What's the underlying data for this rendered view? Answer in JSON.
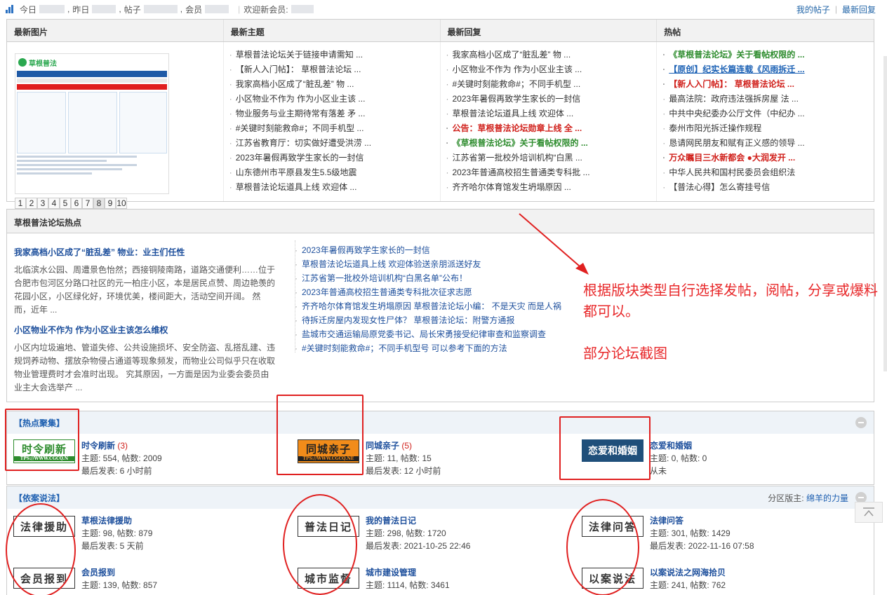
{
  "stats": {
    "today": "今日",
    "yesterday": "昨日",
    "posts": "帖子",
    "members": "会员",
    "welcome": "欢迎新会员:",
    "my_posts": "我的帖子",
    "latest_replies_link": "最新回复"
  },
  "grid": {
    "headers": [
      "最新图片",
      "最新主题",
      "最新回复",
      "热帖"
    ],
    "pager": [
      "1",
      "2",
      "3",
      "4",
      "5",
      "6",
      "7",
      "8",
      "9",
      "10"
    ],
    "pager_active": "8",
    "thumb_site": "草根普法",
    "new_topics": [
      "草根普法论坛关于链接申请需知 ...",
      "【新人入门帖】： 草根普法论坛 ...",
      "我家高档小区成了“脏乱差” 物 ...",
      "小区物业不作为 作为小区业主该 ...",
      "物业服务与业主期待常有落差 矛 ...",
      "#关键时刻能救命#；不同手机型 ...",
      "江苏省教育厅：切实做好遭受洪涝 ...",
      "2023年暑假再致学生家长的一封信",
      "山东德州市平原县发生5.5级地震",
      "草根普法论坛道具上线 欢迎体 ..."
    ],
    "new_replies": [
      "我家高档小区成了“脏乱差” 物 ...",
      "小区物业不作为 作为小区业主该 ...",
      "#关键时刻能救命#；不同手机型 ...",
      "2023年暑假再致学生家长的一封信",
      "草根普法论坛道具上线 欢迎体 ...",
      "公告：草根普法论坛勋章上线 全 ...",
      "《草根普法论坛》关于看帖权限的 ...",
      "江苏省第一批校外培训机构“白黑 ...",
      "2023年普通高校招生普通类专科批 ...",
      "齐齐哈尔体育馆发生坍塌原因 ..."
    ],
    "reply_styles": [
      "",
      "",
      "",
      "",
      "",
      "red",
      "green",
      "",
      "",
      ""
    ],
    "hot_posts": [
      "《草根普法论坛》关于看帖权限的 ...",
      "【原创】纪实长篇连载《风雨拆迁 ...",
      "【新人入门帖】： 草根普法论坛 ...",
      "最高法院：政府违法强拆房屋 法 ...",
      "中共中央纪委办公厅文件（中纪办 ...",
      "泰州市阳光拆迁操作规程",
      "恳请网民朋友和赋有正义感的领导 ...",
      "万众瞩目三水新都会 ●大润发开 ...",
      "中华人民共和国村民委员会组织法",
      "【普法心得】怎么寄挂号信"
    ],
    "hot_styles": [
      "green",
      "blue",
      "red",
      "",
      "",
      "",
      "",
      "red",
      "",
      ""
    ]
  },
  "hot_section": {
    "title": "草根普法论坛热点",
    "articles": [
      {
        "title": "我家高档小区成了“脏乱差” 物业：业主们任性",
        "body": "北临滨水公园、周遭景色怡然；西接铜陵南路，道路交通便利……位于合肥市包河区分路口社区的元一柏庄小区，本是居民点赞、周边艳羡的花园小区，小区绿化好，环境优美，楼间距大，活动空间开阔。 然而，近年 ..."
      },
      {
        "title": "小区物业不作为 作为小区业主该怎么维权",
        "body": "小区内垃圾遍地、管道失修、公共设施损坏、安全防盗、乱搭乱建、违规饲养动物、摆放杂物侵占通道等现象频发，而物业公司似乎只在收取物业管理费时才会准时出现。 究其原因，一方面是因为业委会委员由业主大会选举产 ..."
      }
    ],
    "list": [
      "2023年暑假再致学生家长的一封信",
      "草根普法论坛道具上线 欢迎体验送亲朋派送好友",
      "江苏省第一批校外培训机构“白黑名单”公布！",
      "2023年普通高校招生普通类专科批次征求志愿",
      "齐齐哈尔体育馆发生坍塌原因 草根普法论坛小编： 不是天灾 而是人祸",
      "待拆迁房屋内发现女性尸体？ 草根普法论坛：附警方通报",
      "盐城市交通运输局原党委书记、局长宋勇接受纪律审查和监察调查",
      "#关键时刻能救命#；不同手机型号 可以参考下面的方法"
    ]
  },
  "annotation": {
    "line1": "根据版块类型自行选择发帖，阅帖，分享或爆料都可以。",
    "line2": "部分论坛截图"
  },
  "hotfocus": {
    "title": "【热点聚集】",
    "forums": [
      {
        "logo": "时令刷新",
        "logo_sub": "TPS://WWW.CGCQ.N",
        "name": "时令刷新",
        "count": "(3)",
        "stats": "主题: 554, 帖数: 2009",
        "last": "最后发表: 6 小时前"
      },
      {
        "logo": "同城亲子",
        "logo_sub": "TPS://WWW.CGCQ.NE",
        "name": "同城亲子",
        "count": "(5)",
        "stats": "主题: 11, 帖数: 15",
        "last": "最后发表: 12 小时前"
      },
      {
        "logo": "恋爱和婚姻",
        "logo_sub": "",
        "name": "恋爱和婚姻",
        "count": "",
        "stats": "主题: 0, 帖数: 0",
        "last": "从未"
      }
    ]
  },
  "caselaw": {
    "title": "【依案说法】",
    "moderator_label": "分区版主:",
    "moderator": "绵羊的力量",
    "forums": [
      {
        "logo": "法律援助",
        "name": "草根法律援助",
        "stats": "主题: 98, 帖数: 879",
        "last": "最后发表: 5 天前"
      },
      {
        "logo": "普法日记",
        "name": "我的普法日记",
        "stats": "主题: 298, 帖数: 1720",
        "last": "最后发表: 2021-10-25 22:46"
      },
      {
        "logo": "法律问答",
        "name": "法律问答",
        "stats": "主题: 301, 帖数: 1429",
        "last": "最后发表: 2022-11-16 07:58"
      },
      {
        "logo": "会员报到",
        "name": "会员报到",
        "stats": "主题: 139, 帖数: 857",
        "last": ""
      },
      {
        "logo": "城市监督",
        "name": "城市建设管理",
        "stats": "主题: 1114, 帖数: 3461",
        "last": ""
      },
      {
        "logo": "以案说法",
        "name": "以案说法之网海拾贝",
        "stats": "主题: 241, 帖数: 762",
        "last": ""
      }
    ]
  },
  "colors": {
    "accent_red": "#e02020",
    "link_blue": "#1d4f9c",
    "hot_green": "#2e8c2e"
  }
}
